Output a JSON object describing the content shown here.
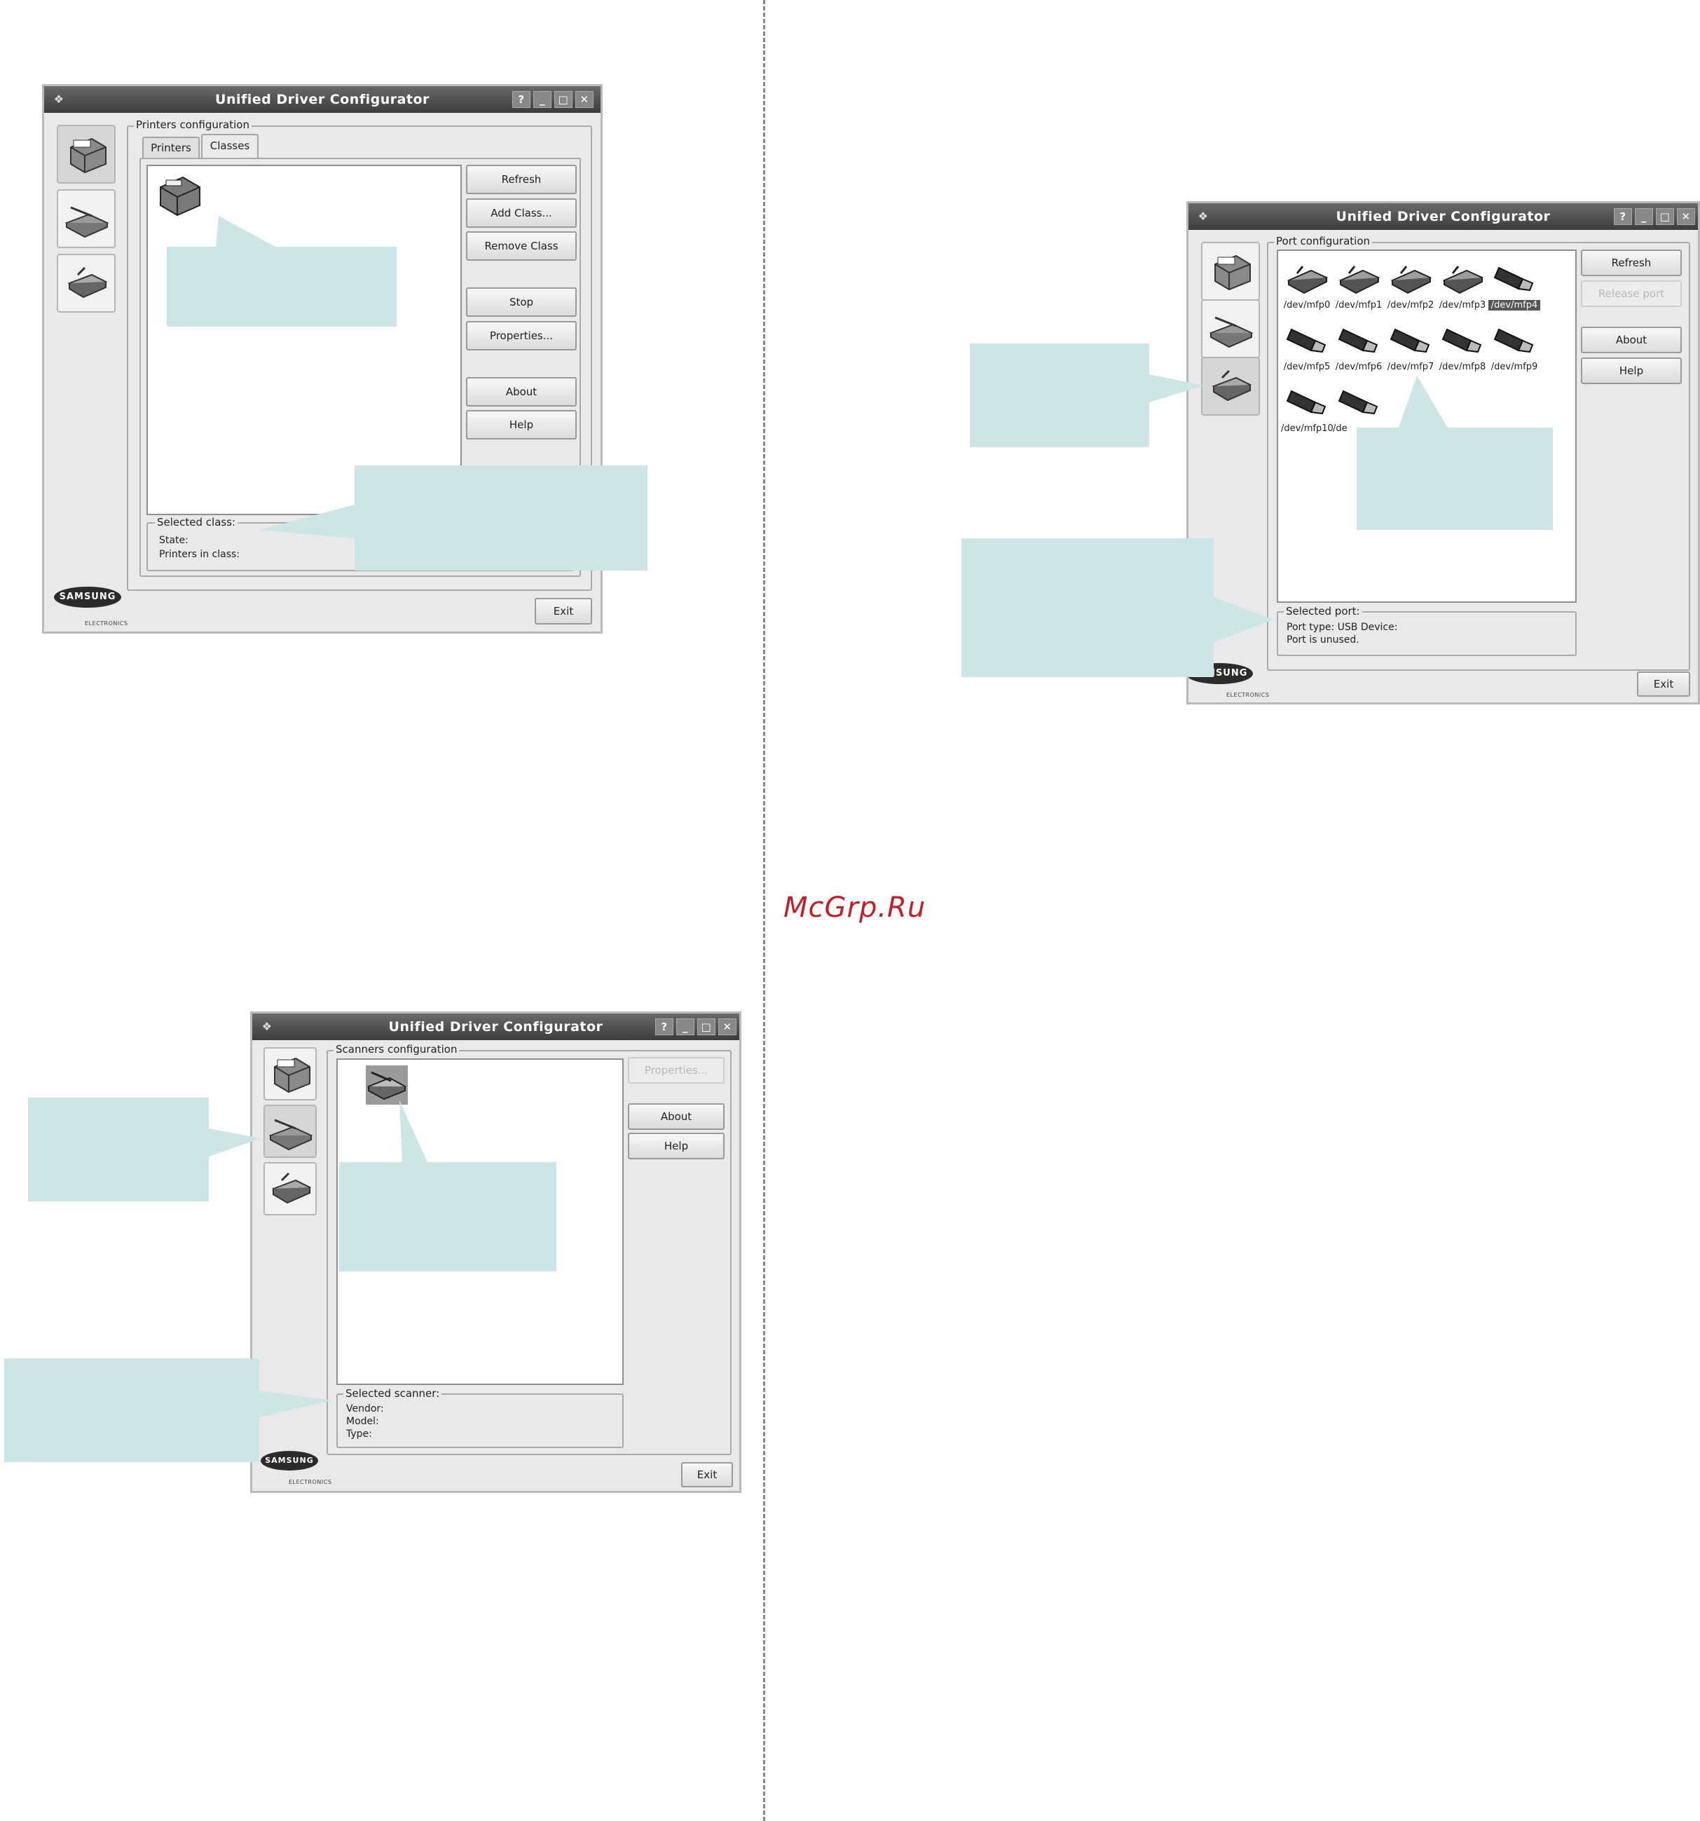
{
  "site_watermark": "McGrp.Ru",
  "window_title": "Unified Driver Configurator",
  "titlebar_buttons": [
    "?",
    "_",
    "□",
    "✕"
  ],
  "brand": {
    "logo": "SAMSUNG",
    "sub": "ELECTRONICS"
  },
  "exit_label": "Exit",
  "printers": {
    "group": "Printers configuration",
    "tabs": [
      "Printers",
      "Classes"
    ],
    "buttons": [
      "Refresh",
      "Add Class...",
      "Remove Class",
      "Stop",
      "Properties...",
      "About",
      "Help"
    ],
    "info_group": "Selected class:",
    "info_lines": [
      "State:",
      "Printers in class:"
    ]
  },
  "ports": {
    "group": "Port configuration",
    "buttons": [
      "Refresh",
      "Release port",
      "About",
      "Help"
    ],
    "items": [
      "/dev/mfp0",
      "/dev/mfp1",
      "/dev/mfp2",
      "/dev/mfp3",
      "/dev/mfp4",
      "/dev/mfp5",
      "/dev/mfp6",
      "/dev/mfp7",
      "/dev/mfp8",
      "/dev/mfp9",
      "/dev/mfp10",
      "/de"
    ],
    "info_group": "Selected port:",
    "info_lines": [
      "Port type: USB   Device:",
      "Port is unused."
    ]
  },
  "scanners": {
    "group": "Scanners configuration",
    "buttons": [
      "Properties...",
      "About",
      "Help"
    ],
    "info_group": "Selected scanner:",
    "info_lines": [
      "Vendor:",
      "Model:",
      "Type:"
    ]
  }
}
